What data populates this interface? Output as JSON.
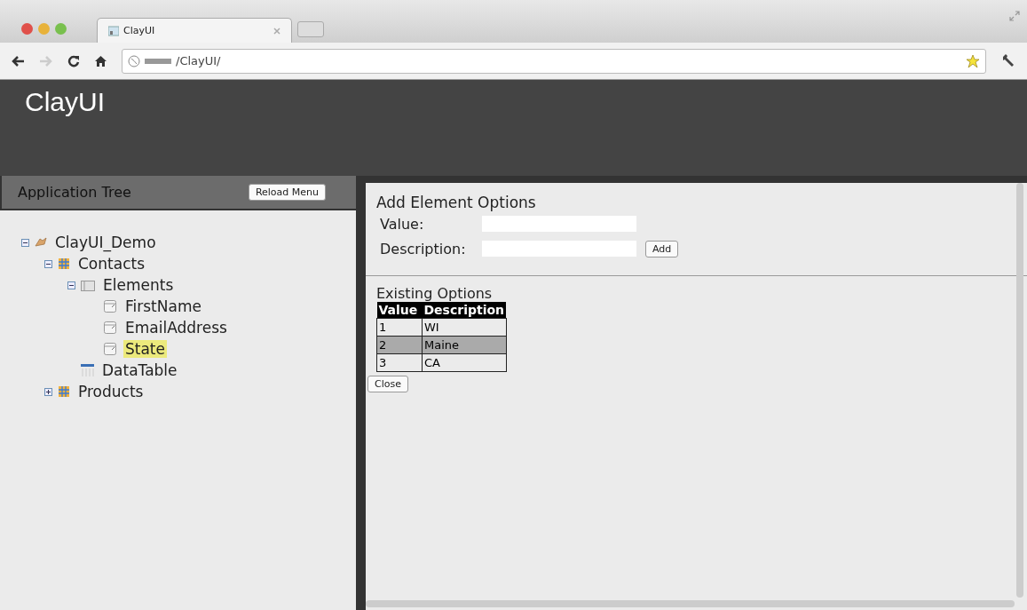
{
  "browser": {
    "tab_title": "ClayUI",
    "url": "/ClayUI/"
  },
  "header": {
    "title": "ClayUI"
  },
  "sidebar": {
    "title": "Application Tree",
    "reload_button": "Reload Menu",
    "tree": [
      {
        "label": "ClayUI_Demo",
        "kind": "app",
        "expanded": true,
        "selected": false,
        "children": [
          {
            "label": "Contacts",
            "kind": "form",
            "expanded": true,
            "selected": false,
            "children": [
              {
                "label": "Elements",
                "kind": "folder",
                "expanded": true,
                "selected": false,
                "children": [
                  {
                    "label": "FirstName",
                    "kind": "field",
                    "selected": false
                  },
                  {
                    "label": "EmailAddress",
                    "kind": "field",
                    "selected": false
                  },
                  {
                    "label": "State",
                    "kind": "field",
                    "selected": true
                  }
                ]
              },
              {
                "label": "DataTable",
                "kind": "table",
                "selected": false
              }
            ]
          },
          {
            "label": "Products",
            "kind": "form",
            "expanded": false,
            "selected": false
          }
        ]
      }
    ]
  },
  "panel": {
    "title": "Add Element Options",
    "fields": [
      {
        "label": "Value:"
      },
      {
        "label": "Description:"
      }
    ],
    "add_button": "Add",
    "existing_title": "Existing Options",
    "table": {
      "columns": [
        "Value",
        "Description"
      ],
      "rows": [
        {
          "cells": [
            "1",
            "WI"
          ],
          "selected": false
        },
        {
          "cells": [
            "2",
            "Maine"
          ],
          "selected": true
        },
        {
          "cells": [
            "3",
            "CA"
          ],
          "selected": false
        }
      ]
    },
    "close_button": "Close"
  }
}
